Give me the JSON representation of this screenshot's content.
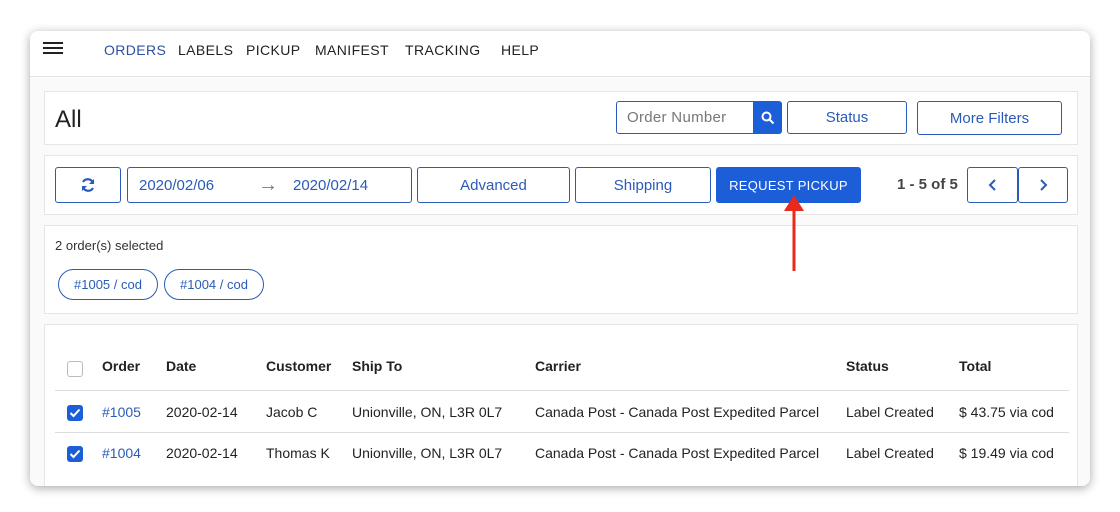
{
  "nav": {
    "menu_icon": "hamburger-menu-icon",
    "items": [
      "ORDERS",
      "LABELS",
      "PICKUP",
      "MANIFEST",
      "TRACKING",
      "HELP"
    ],
    "active": "ORDERS"
  },
  "header": {
    "title": "All",
    "search_placeholder": "Order Number",
    "search_icon": "search-icon",
    "status_label": "Status",
    "more_filters_label": "More Filters"
  },
  "toolbar": {
    "refresh_icon": "refresh-icon",
    "date_from": "2020/02/06",
    "date_arrow": "→",
    "date_to": "2020/02/14",
    "advanced_label": "Advanced",
    "shipping_label": "Shipping",
    "request_pickup_label": "REQUEST PICKUP",
    "page_info": "1 - 5 of 5",
    "prev_icon": "chevron-left-icon",
    "next_icon": "chevron-right-icon"
  },
  "selection": {
    "summary": "2 order(s) selected",
    "chips": [
      "#1005 / cod",
      "#1004 / cod"
    ]
  },
  "table": {
    "columns": [
      "Order",
      "Date",
      "Customer",
      "Ship To",
      "Carrier",
      "Status",
      "Total"
    ],
    "rows": [
      {
        "checked": true,
        "order": "#1005",
        "date": "2020-02-14",
        "customer": "Jacob C",
        "ship_to": "Unionville, ON, L3R 0L7",
        "carrier": "Canada Post - Canada Post Expedited Parcel",
        "status": "Label Created",
        "total": "$ 43.75 via cod"
      },
      {
        "checked": true,
        "order": "#1004",
        "date": "2020-02-14",
        "customer": "Thomas K",
        "ship_to": "Unionville, ON, L3R 0L7",
        "carrier": "Canada Post - Canada Post Expedited Parcel",
        "status": "Label Created",
        "total": "$ 19.49 via cod"
      }
    ]
  },
  "colors": {
    "accent": "#1c5ed8",
    "link": "#2a5bb8",
    "annotation_arrow": "#e8291c"
  }
}
